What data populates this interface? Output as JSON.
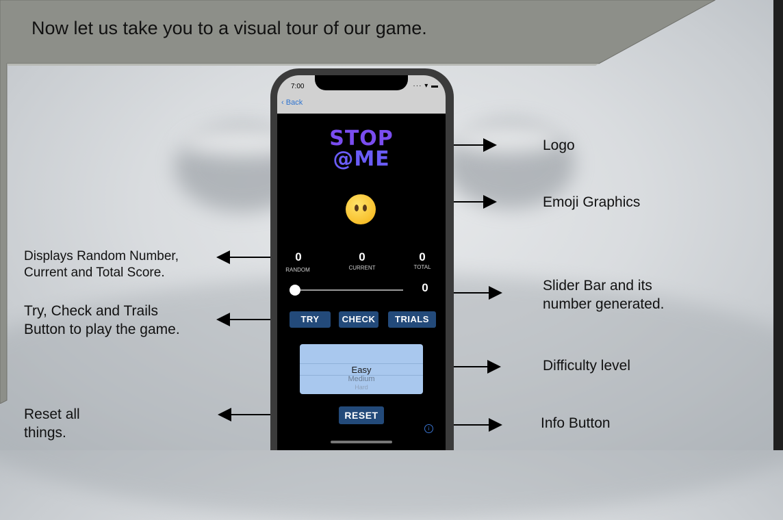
{
  "banner": {
    "text": "Now let us take you to a visual tour of our game."
  },
  "callouts": {
    "logo": "Logo",
    "emoji": "Emoji Graphics",
    "scores_1": "Displays Random Number,",
    "scores_2": "Current and Total Score.",
    "slider_1": "Slider Bar and its",
    "slider_2": "number generated.",
    "buttons_1": "Try, Check and Trails",
    "buttons_2": "Button to play the game.",
    "difficulty": "Difficulty level",
    "reset_1": "Reset all",
    "reset_2": "things.",
    "info": "Info Button"
  },
  "phone": {
    "status_time": "7:00",
    "status_icons": "···",
    "back_label": "Back",
    "logo_line1": "STOP",
    "logo_line2": "@ME",
    "emoji_icon": "face-without-mouth-emoji",
    "scores": {
      "random_value": "0",
      "random_label": "RANDOM",
      "current_value": "0",
      "current_label": "CURRENT",
      "total_value": "0",
      "total_label": "TOTAL"
    },
    "slider_value": "0",
    "slider_level": 0,
    "buttons": {
      "try": "TRY",
      "check": "CHECK",
      "trials": "TRIALS",
      "reset": "RESET"
    },
    "difficulty": {
      "selected": "Easy",
      "options": [
        "Easy",
        "Medium",
        "Hard"
      ]
    },
    "info_glyph": "i"
  },
  "colors": {
    "button_bg": "#234a7a",
    "picker_bg": "#a9c8ee",
    "logo": "#7a4df0"
  }
}
